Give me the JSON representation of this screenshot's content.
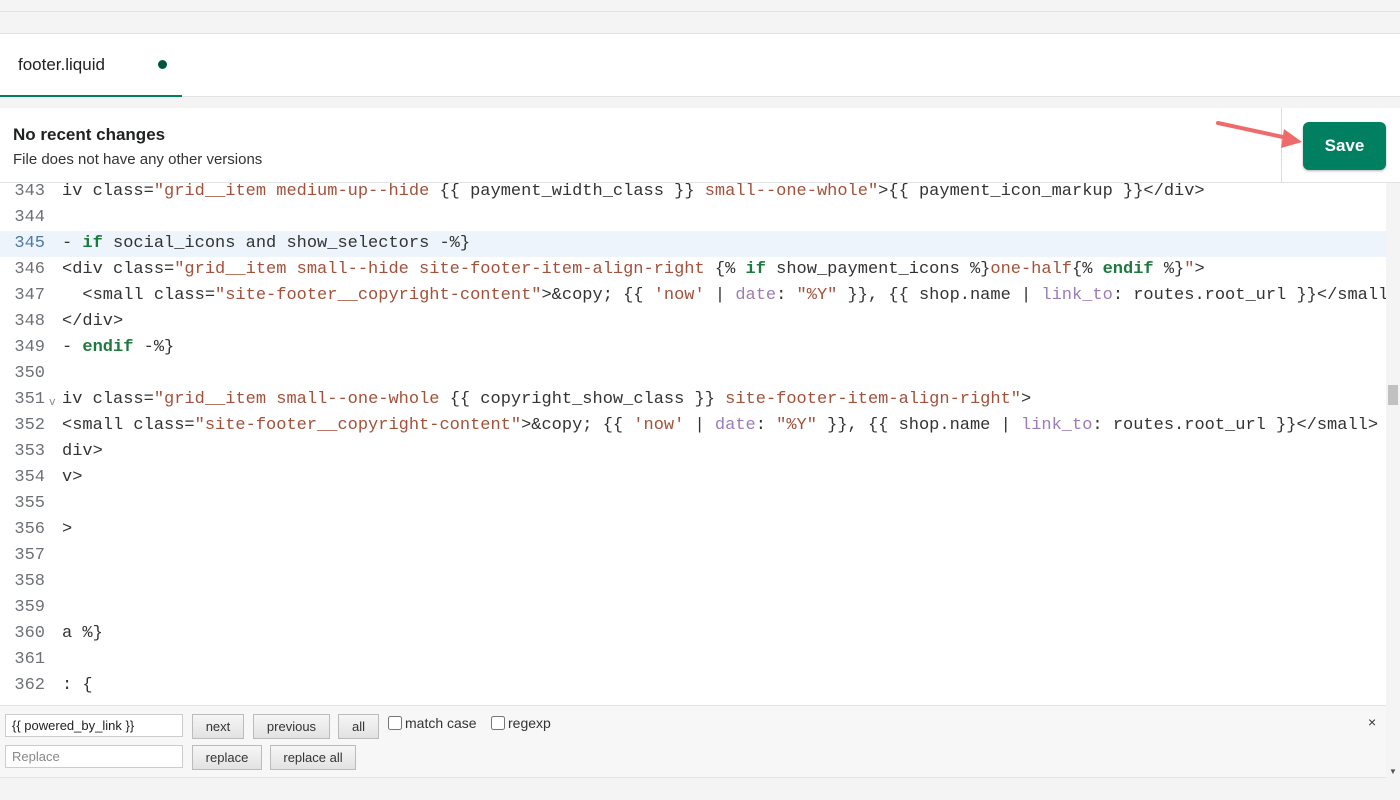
{
  "tab": {
    "label": "footer.liquid",
    "unsaved": true
  },
  "header": {
    "title": "No recent changes",
    "subtitle": "File does not have any other versions",
    "save_label": "Save"
  },
  "colors": {
    "accent": "#008060",
    "arrow": "#ef6b6b",
    "string": "#a3513a",
    "keyword": "#1d7a3f",
    "filter": "#9b7bb8"
  },
  "editor": {
    "active_line": 345,
    "fold_line": 351,
    "lines": [
      {
        "n": "343",
        "tokens": [
          [
            "t",
            "iv class="
          ],
          [
            "s",
            "\"grid__item medium-up--hide "
          ],
          [
            "t",
            "{{ payment_width_class }}"
          ],
          [
            "s",
            " small--one-whole\""
          ],
          [
            "t",
            ">{{ payment_icon_markup }}</div>"
          ]
        ]
      },
      {
        "n": "344",
        "tokens": []
      },
      {
        "n": "345",
        "tokens": [
          [
            "t",
            "- "
          ],
          [
            "k",
            "if"
          ],
          [
            "t",
            " social_icons and show_selectors -%}"
          ]
        ]
      },
      {
        "n": "346",
        "tokens": [
          [
            "t",
            "<div class="
          ],
          [
            "s",
            "\"grid__item small--hide site-footer-item-align-right "
          ],
          [
            "t",
            "{% "
          ],
          [
            "k",
            "if"
          ],
          [
            "t",
            " show_payment_icons %}"
          ],
          [
            "s",
            "one-half"
          ],
          [
            "t",
            "{% "
          ],
          [
            "k",
            "endif"
          ],
          [
            "t",
            " %}"
          ],
          [
            "s",
            "\""
          ],
          [
            "t",
            ">"
          ]
        ]
      },
      {
        "n": "347",
        "tokens": [
          [
            "t",
            "  <small class="
          ],
          [
            "s",
            "\"site-footer__copyright-content\""
          ],
          [
            "t",
            ">&copy; {{ "
          ],
          [
            "s",
            "'now'"
          ],
          [
            "t",
            " | "
          ],
          [
            "f",
            "date"
          ],
          [
            "t",
            ": "
          ],
          [
            "s",
            "\"%Y\""
          ],
          [
            "t",
            " }}, {{ shop.name | "
          ],
          [
            "f",
            "link_to"
          ],
          [
            "t",
            ": routes.root_url }}</small"
          ]
        ]
      },
      {
        "n": "348",
        "tokens": [
          [
            "t",
            "</div>"
          ]
        ]
      },
      {
        "n": "349",
        "tokens": [
          [
            "t",
            "- "
          ],
          [
            "k",
            "endif"
          ],
          [
            "t",
            " -%}"
          ]
        ]
      },
      {
        "n": "350",
        "tokens": []
      },
      {
        "n": "351",
        "tokens": [
          [
            "t",
            "iv class="
          ],
          [
            "s",
            "\"grid__item small--one-whole "
          ],
          [
            "t",
            "{{ copyright_show_class }}"
          ],
          [
            "s",
            " site-footer-item-align-right\""
          ],
          [
            "t",
            ">"
          ]
        ]
      },
      {
        "n": "352",
        "tokens": [
          [
            "t",
            "<small class="
          ],
          [
            "s",
            "\"site-footer__copyright-content\""
          ],
          [
            "t",
            ">&copy; {{ "
          ],
          [
            "s",
            "'now'"
          ],
          [
            "t",
            " | "
          ],
          [
            "f",
            "date"
          ],
          [
            "t",
            ": "
          ],
          [
            "s",
            "\"%Y\""
          ],
          [
            "t",
            " }}, {{ shop.name | "
          ],
          [
            "f",
            "link_to"
          ],
          [
            "t",
            ": routes.root_url }}</small>"
          ]
        ]
      },
      {
        "n": "353",
        "tokens": [
          [
            "t",
            "div>"
          ]
        ]
      },
      {
        "n": "354",
        "tokens": [
          [
            "t",
            "v>"
          ]
        ]
      },
      {
        "n": "355",
        "tokens": []
      },
      {
        "n": "356",
        "tokens": [
          [
            "t",
            ">"
          ]
        ]
      },
      {
        "n": "357",
        "tokens": []
      },
      {
        "n": "358",
        "tokens": []
      },
      {
        "n": "359",
        "tokens": []
      },
      {
        "n": "360",
        "tokens": [
          [
            "t",
            "a %}"
          ]
        ]
      },
      {
        "n": "361",
        "tokens": []
      },
      {
        "n": "362",
        "tokens": [
          [
            "t",
            ": {"
          ]
        ]
      }
    ]
  },
  "search": {
    "find_value": "{{ powered_by_link }}",
    "replace_placeholder": "Replace",
    "next_label": "next",
    "previous_label": "previous",
    "all_label": "all",
    "match_case_label": "match case",
    "regexp_label": "regexp",
    "replace_label": "replace",
    "replace_all_label": "replace all",
    "close_label": "×"
  }
}
